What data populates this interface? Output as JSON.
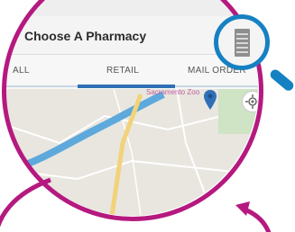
{
  "colors": {
    "lens_ring": "#b5197f",
    "magnifier": "#1681c2",
    "tab_indicator": "#2f6fb6",
    "map_label": "#c35ea0",
    "map_pin": "#2f6fb6",
    "river": "#5ea9dc",
    "road": "#f2d27a"
  },
  "header": {
    "title": "Choose A Pharmacy",
    "menu_icon": "hamburger-menu-icon"
  },
  "tabs": [
    {
      "label": "ALL",
      "active": false
    },
    {
      "label": "RETAIL",
      "active": true
    },
    {
      "label": "MAIL ORDER",
      "active": false
    }
  ],
  "map": {
    "label": "Sacramento Zoo",
    "pin_icon": "map-pin-icon",
    "location_icon": "my-location-icon"
  },
  "annotations": {
    "magnifier_icon": "magnifying-glass-icon",
    "arrow_icon": "curved-arrow-icon"
  }
}
